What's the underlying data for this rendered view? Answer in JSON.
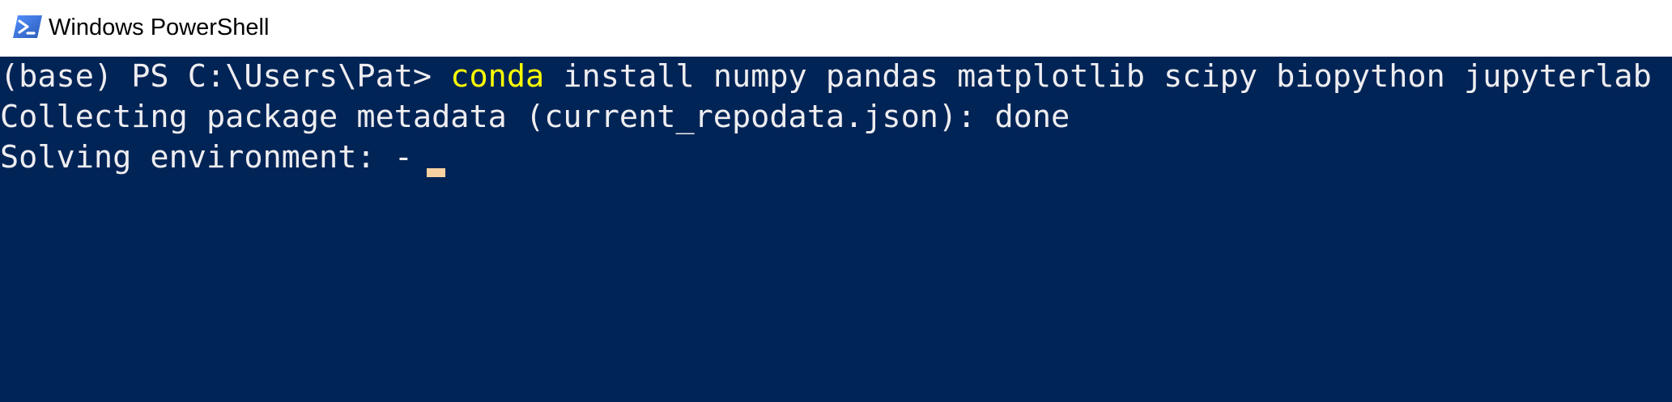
{
  "window": {
    "title": "Windows PowerShell",
    "icon": "powershell-icon"
  },
  "console": {
    "background": "#012456",
    "foreground": "#eeedf0",
    "keyword_color": "#ffff00",
    "cursor_color": "#f7d2a0",
    "lines": [
      {
        "prompt": "(base) PS C:\\Users\\Pat> ",
        "command": "conda",
        "args": " install numpy pandas matplotlib scipy biopython jupyterlab"
      },
      {
        "text": "Collecting package metadata (current_repodata.json): done"
      },
      {
        "text": "Solving environment: - "
      }
    ]
  }
}
